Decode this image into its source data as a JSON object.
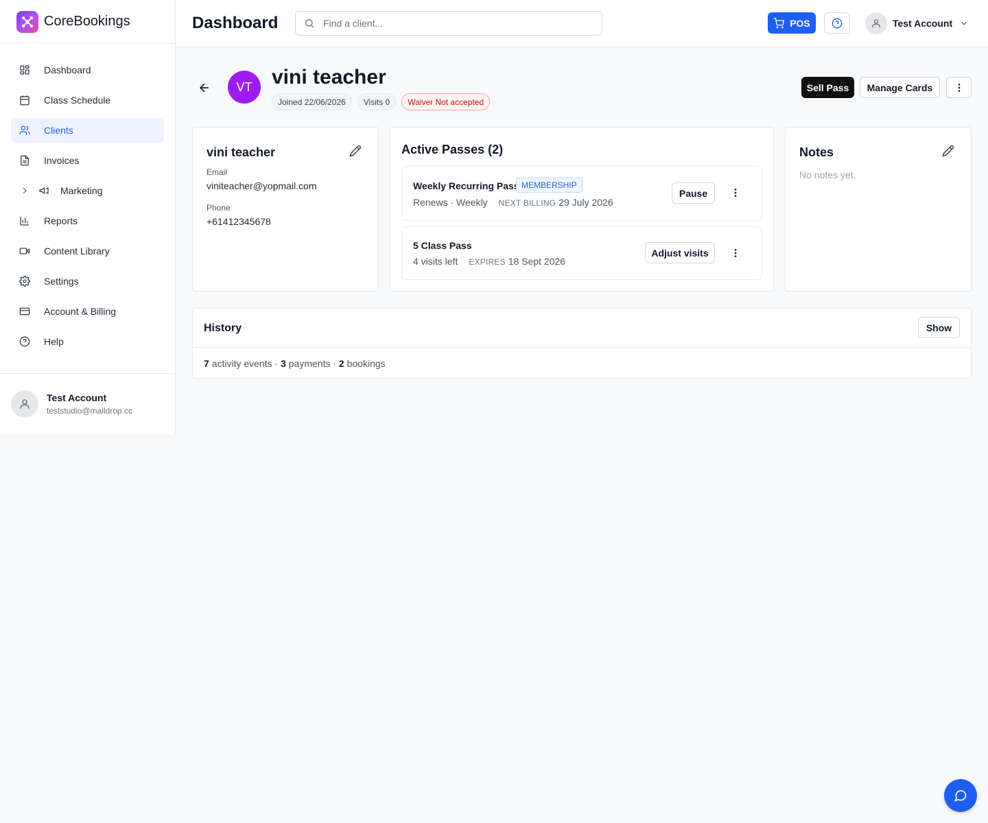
{
  "brand": {
    "name": "CoreBookings",
    "logo_icon": "network-logo-icon",
    "accent": "#7c3aed"
  },
  "sidebar": {
    "items": [
      {
        "label": "Dashboard",
        "icon": "dashboard-icon"
      },
      {
        "label": "Class Schedule",
        "icon": "calendar-icon"
      },
      {
        "label": "Clients",
        "icon": "users-icon",
        "active": true
      },
      {
        "label": "Invoices",
        "icon": "document-icon"
      },
      {
        "label": "Marketing",
        "icon": "megaphone-icon",
        "expandable": true
      },
      {
        "label": "Reports",
        "icon": "bar-chart-icon"
      },
      {
        "label": "Content Library",
        "icon": "video-icon"
      },
      {
        "label": "Settings",
        "icon": "gear-icon"
      },
      {
        "label": "Account & Billing",
        "icon": "credit-card-icon"
      },
      {
        "label": "Help",
        "icon": "help-circle-icon"
      }
    ],
    "user": {
      "name": "Test Account",
      "email": "teststudio@maildrop.cc"
    }
  },
  "header": {
    "title": "Dashboard",
    "search_placeholder": "Find a client...",
    "pos_label": "POS",
    "account_name": "Test Account"
  },
  "client": {
    "initials": "VT",
    "name": "vini teacher",
    "joined": "Joined 22/06/2026",
    "visits": "Visits 0",
    "waiver": "Waiver Not accepted",
    "avatar_color": "#9d1cf5"
  },
  "actions": {
    "sell_pass": "Sell Pass",
    "manage_cards": "Manage Cards"
  },
  "info": {
    "name": "vini teacher",
    "email_label": "Email",
    "email": "viniteacher@yopmail.com",
    "phone_label": "Phone",
    "phone": "+61412345678"
  },
  "passes": {
    "title": "Active Passes (2)",
    "items": [
      {
        "name": "Weekly Recurring Pass",
        "badge": "MEMBERSHIP",
        "meta": "Renews · Weekly",
        "key": "NEXT BILLING",
        "value": "29 July 2026",
        "button": "Pause"
      },
      {
        "name": "5 Class Pass",
        "meta": "4 visits left",
        "key": "EXPIRES",
        "value": "18 Sept 2026",
        "button": "Adjust visits"
      }
    ]
  },
  "notes": {
    "title": "Notes",
    "empty": "No notes yet."
  },
  "history": {
    "title": "History",
    "show_label": "Show",
    "activity_count": "7",
    "activity_label": "activity events",
    "payments_count": "3",
    "payments_label": "payments",
    "bookings_count": "2",
    "bookings_label": "bookings",
    "separator": " · "
  },
  "chat": {
    "icon": "chat-bubble-icon"
  }
}
